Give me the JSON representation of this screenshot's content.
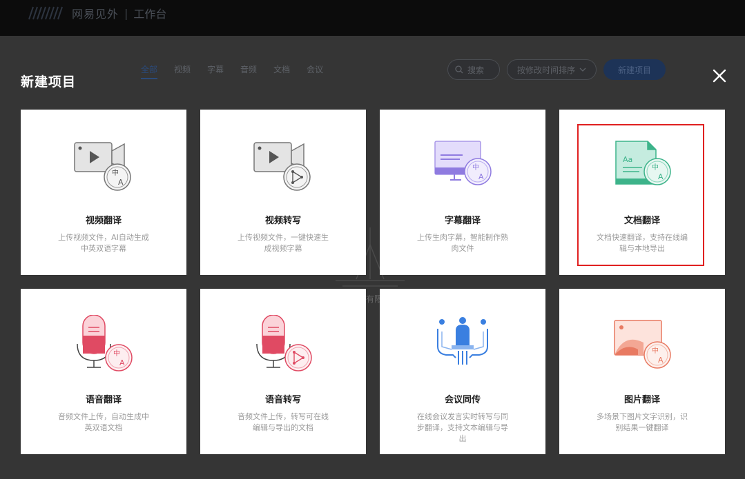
{
  "topbar": {
    "brand": "网易见外",
    "separator": "|",
    "subtitle": "工作台"
  },
  "dialog": {
    "title": "新建项目",
    "tabs": [
      {
        "label": "全部",
        "active": true
      },
      {
        "label": "视频",
        "active": false
      },
      {
        "label": "字幕",
        "active": false
      },
      {
        "label": "音频",
        "active": false
      },
      {
        "label": "文档",
        "active": false
      },
      {
        "label": "会议",
        "active": false
      }
    ],
    "search_label": "搜索",
    "sort_label": "按修改时间排序",
    "new_button": "新建项目",
    "close_icon": "close-icon"
  },
  "cards": [
    {
      "title": "视频翻译",
      "desc": "上传视频文件，AI自动生成中英双语字幕",
      "icon": "video-translate-icon"
    },
    {
      "title": "视频转写",
      "desc": "上传视频文件，一键快速生成视频字幕",
      "icon": "video-transcribe-icon"
    },
    {
      "title": "字幕翻译",
      "desc": "上传生肉字幕，智能制作熟肉文件",
      "icon": "subtitle-translate-icon"
    },
    {
      "title": "文档翻译",
      "desc": "文档快速翻译，支持在线编辑与本地导出",
      "icon": "document-translate-icon"
    },
    {
      "title": "语音翻译",
      "desc": "音频文件上传，自动生成中英双语文档",
      "icon": "audio-translate-icon"
    },
    {
      "title": "语音转写",
      "desc": "音频文件上传，转写可在线编辑与导出的文档",
      "icon": "audio-transcribe-icon"
    },
    {
      "title": "会议同传",
      "desc": "在线会议发言实时转写与同步翻译，支持文本编辑与导出",
      "icon": "meeting-interpret-icon"
    },
    {
      "title": "图片翻译",
      "desc": "多场景下图片文字识别，识别结果一键翻译",
      "icon": "image-translate-icon"
    }
  ],
  "colors": {
    "highlight": "#e02020",
    "accent": "#1d3357"
  },
  "watermark_text": "有限"
}
